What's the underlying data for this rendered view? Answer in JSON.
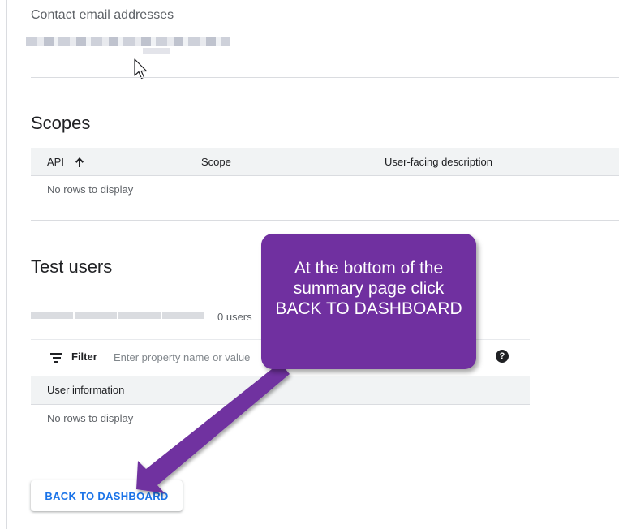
{
  "contact": {
    "label": "Contact email addresses"
  },
  "scopes": {
    "title": "Scopes",
    "columns": {
      "api": "API",
      "scope": "Scope",
      "description": "User-facing description"
    },
    "empty_text": "No rows to display"
  },
  "test_users": {
    "title": "Test users",
    "count_text": "0 users",
    "filter": {
      "label": "Filter",
      "placeholder": "Enter property name or value"
    },
    "columns": {
      "user_info": "User information"
    },
    "empty_text": "No rows to display"
  },
  "back_button": {
    "label": "BACK TO DASHBOARD"
  },
  "callout": {
    "text": "At the bottom of the summary page click BACK TO DASHBOARD"
  },
  "colors": {
    "callout_bg": "#7030a0",
    "button_text": "#1a73e8",
    "header_bg": "#f1f3f4"
  },
  "icons": [
    "mouse-cursor-icon",
    "sort-arrow-up-icon",
    "filter-icon",
    "help-icon",
    "pointer-arrow-icon"
  ]
}
